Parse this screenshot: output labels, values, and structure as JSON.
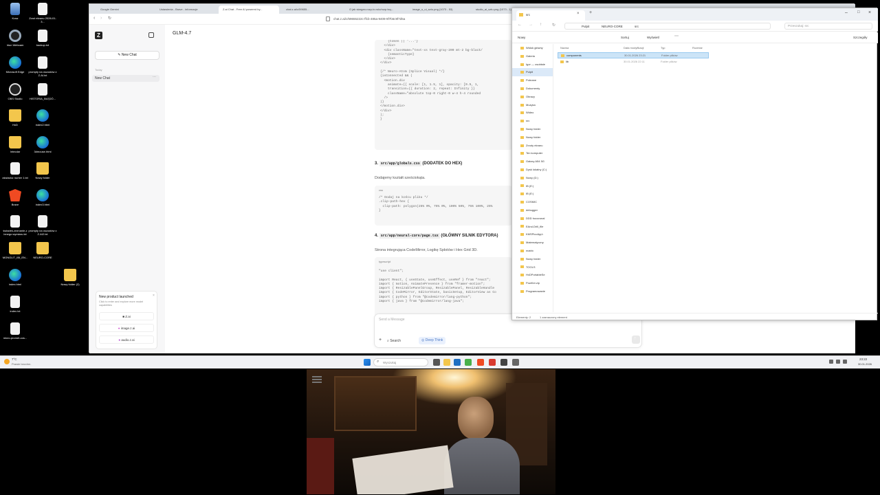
{
  "desktop": {
    "icons": [
      {
        "label": "Kosz",
        "kind": "bin"
      },
      {
        "label": "Zrzut ekranu 2026-01-3...",
        "kind": "file"
      },
      {
        "label": "Iriun Webcam",
        "kind": "cam"
      },
      {
        "label": "backup.txt",
        "kind": "file"
      },
      {
        "label": "Microsoft Edge",
        "kind": "edge"
      },
      {
        "label": "prompty na oszustów z Z.AI.txt",
        "kind": "file"
      },
      {
        "label": "OBS Studio",
        "kind": "obs"
      },
      {
        "label": "HISTORIA_BŁĘDÓ...",
        "kind": "file"
      },
      {
        "label": "HxD",
        "kind": "folder"
      },
      {
        "label": "index2.html",
        "kind": "edge"
      },
      {
        "label": "Intecdar",
        "kind": "folder"
      },
      {
        "label": "3dmouse.html",
        "kind": "edge"
      },
      {
        "label": "oświadcz numer 1.txt",
        "kind": "file"
      },
      {
        "label": "Nowy folder",
        "kind": "folder"
      },
      {
        "label": "Brave",
        "kind": "brave"
      },
      {
        "label": "index3.html",
        "kind": "edge"
      },
      {
        "label": "świadek-zeznanie-z innego wymiaru.txt",
        "kind": "file"
      },
      {
        "label": "prompty na oszustów z Z.AI2.txt",
        "kind": "file"
      },
      {
        "label": "MONOLIT_IBI_EN...",
        "kind": "folder"
      },
      {
        "label": "NEURO-CORE",
        "kind": "folder"
      },
      {
        "label": "Nowy folder (2)",
        "kind": "folder"
      },
      {
        "label": "index.html",
        "kind": "edge"
      },
      {
        "label": "index.txt",
        "kind": "file"
      },
      {
        "label": "micro-promet-cos...",
        "kind": "file"
      }
    ]
  },
  "browser": {
    "tabs": [
      "Google Gemini",
      "Ustawienia - Brave - informacje",
      "Z.ai Chat - Free AI powered by...",
      "chat.z.ai/c/59655...",
      "O jak stargan-rozp-to.rolo/rozp.tsq...",
      "image_s_ui_sztu.png (1073 - 53)",
      "studio_ai_sztu.png (1073 - 1)..."
    ],
    "url": "chat.z.ai/c/59655222c-ffcb-485a-9409-9f7b5c9f7d5a",
    "sidebar": {
      "new_chat": "New Chat",
      "today": "Today",
      "history_item": "New Chat",
      "promo_title": "New product launched",
      "promo_text": "Click to enter and explore more model capabilities",
      "promo_items": [
        "Z.ai",
        "image.z.ai",
        "audio.z.ai"
      ]
    },
    "main": {
      "model": "GLM-4.7",
      "section3_path": "src/app/globals.css",
      "section3_title": "(DODATEK DO HEX)",
      "section3_desc": "Dodajemy kształt sześciokąta.",
      "css_lang": "css",
      "section4_path": "src/app/neural-core/page.tsx",
      "section4_title": "(GŁÓWNY SILNIK EDYTORA)",
      "section4_desc": "Strona integrująca CodeMirror, Logikę Splotów i Hex Grid 3D.",
      "ts_lang": "typescript",
      "input_placeholder": "Send a Message",
      "search_btn": "Search",
      "deepthink_btn": "Deep Think",
      "num3": "3.",
      "num4": "4.",
      "code_top": [
        "    {token || '...'}",
        "  </div>",
        "  <div className=\"text-xs text-gray-200 mt-2 bg-black/",
        "    {semanticType}",
        "  </div>",
        "</div>",
        "",
        "{/* Neuro-Atom (Splice Visual) */}",
        "{isConnected && (",
        "  <motion.div",
        "    animate={{ scale: [1, 1.5, 1], opacity: [0.5, 1,",
        "    transition={{ duration: 2, repeat: Infinity }}",
        "    className=\"absolute top-0 right-0 w-4 h-4 rounded",
        "  />",
        ")}",
        "</motion.div>",
        "</div>",
        ");",
        "}"
      ],
      "code_css": [
        "/* Dodaj na końcu pliku */",
        ".clip-path-hex {",
        "  clip-path: polygon(25% 0%, 75% 0%, 100% 50%, 75% 100%, 25%",
        "}"
      ],
      "code_ts": [
        "\"use client\";",
        "",
        "import React, { useState, useEffect, useRef } from \"react\";",
        "import { motion, AnimatePresence } from \"framer-motion\";",
        "import { ResizablePanelGroup, ResizablePanel, ResizableHandle",
        "import { CodeMirror, EditorState, basicSetup, EditorView as Co",
        "import { python } from \"@codemirror/lang-python\";",
        "import { java } from \"@codemirror/lang-java\";"
      ]
    }
  },
  "explorer": {
    "tab_title": "src",
    "breadcrumb": [
      "Pulpit",
      "NEURO-CORE",
      "src"
    ],
    "search_placeholder": "Przeszukaj: src",
    "toolbar": [
      "Nowy",
      "Sortuj",
      "Wyświetl",
      "Szczegóły"
    ],
    "columns": [
      "Nazwa",
      "Data modyfikacji",
      "Typ",
      "Rozmiar"
    ],
    "rows": [
      {
        "name": "components",
        "date": "30.01.2026 23:21",
        "type": "Folder plików",
        "selected": true
      },
      {
        "name": "lib",
        "date": "30.01.2026 22:11",
        "type": "Folder plików",
        "selected": false
      }
    ],
    "nav": [
      "Widok główny",
      "Galeria",
      "Igor — osobiste",
      "Pulpit",
      "Pobrane",
      "Dokumenty",
      "Obrazy",
      "Muzyka",
      "Wideo",
      "src",
      "Nowy folder",
      "Nowy folder",
      "Zrzuty ekranu",
      "Ten komputer",
      "Galaxy A54 5G",
      "Dysk lokalny (C:)",
      "Nowy (D:)",
      "IB (E:)",
      "IB (E:)",
      "COSMIC",
      "debugger",
      "DDD hoocrunal",
      "EAnd-Drill_file",
      "KMSPicoApp\\",
      "Matematyczny",
      "matrix",
      "Nowy folder",
      "TOOLS",
      "HxDPortableSe",
      "PowKer.zip",
      "Programowanie"
    ],
    "status_items": "Elementy: 2",
    "status_selected": "1 zaznaczony element"
  },
  "taskbar": {
    "weather_temp": "7°C",
    "weather_desc": "Prawie bezchm.",
    "search_placeholder": "Wyszukaj",
    "time": "23:22",
    "date": "30.01.2026"
  }
}
